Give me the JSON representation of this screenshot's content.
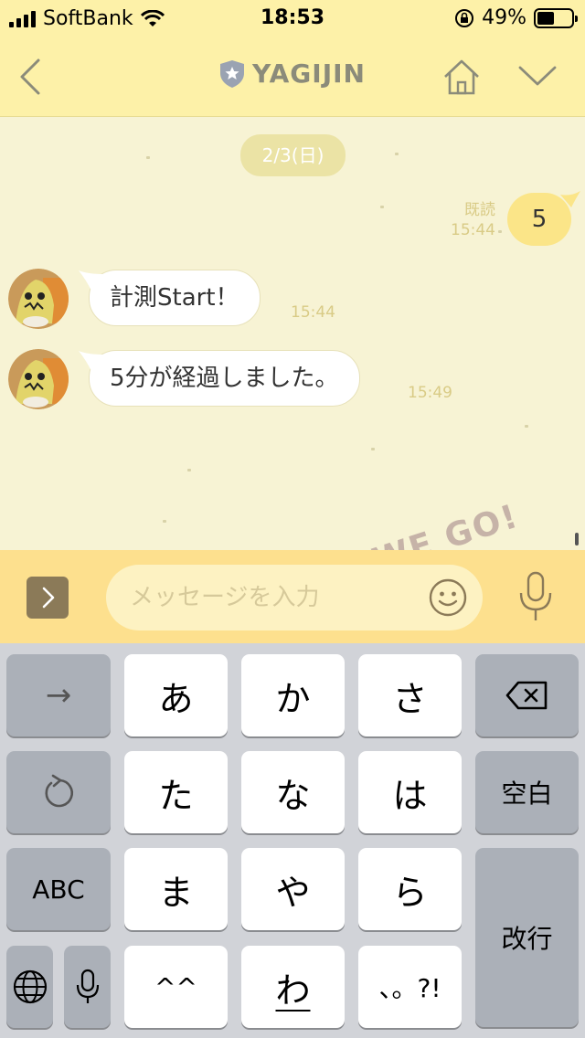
{
  "status_bar": {
    "carrier": "SoftBank",
    "time": "18:53",
    "battery_percent": "49%",
    "battery_level": 0.49
  },
  "header": {
    "title": "YAGIJIN",
    "icons": [
      "back-chevron-icon",
      "shield-star-icon",
      "home-icon",
      "chevron-down-icon"
    ]
  },
  "chat": {
    "date_separator": "2/3(日)",
    "sent_message": {
      "text": "5",
      "read_label": "既読",
      "time": "15:44"
    },
    "received_messages": [
      {
        "text": "計測Start！",
        "time": "15:44"
      },
      {
        "text": "5分が経過しました。",
        "time": "15:49"
      }
    ],
    "sticker_text": "WE GO!"
  },
  "input_bar": {
    "placeholder": "メッセージを入力",
    "value": ""
  },
  "keyboard": {
    "row1": [
      "→",
      "あ",
      "か",
      "さ",
      "⌫"
    ],
    "row2": [
      "↺",
      "た",
      "な",
      "は",
      "空白"
    ],
    "row3": [
      "ABC",
      "ま",
      "や",
      "ら",
      "改行"
    ],
    "row4": [
      "🌐",
      "🎤",
      "^^",
      "わ",
      "、。?!"
    ],
    "space_label": "空白",
    "return_label": "改行",
    "abc_label": "ABC"
  },
  "colors": {
    "header_bg": "#fdf1a8",
    "chat_bg": "#f7f3d4",
    "input_bar_bg": "#fde08e",
    "sent_bubble": "#fbe588",
    "keyboard_bg": "#d1d3d8"
  }
}
